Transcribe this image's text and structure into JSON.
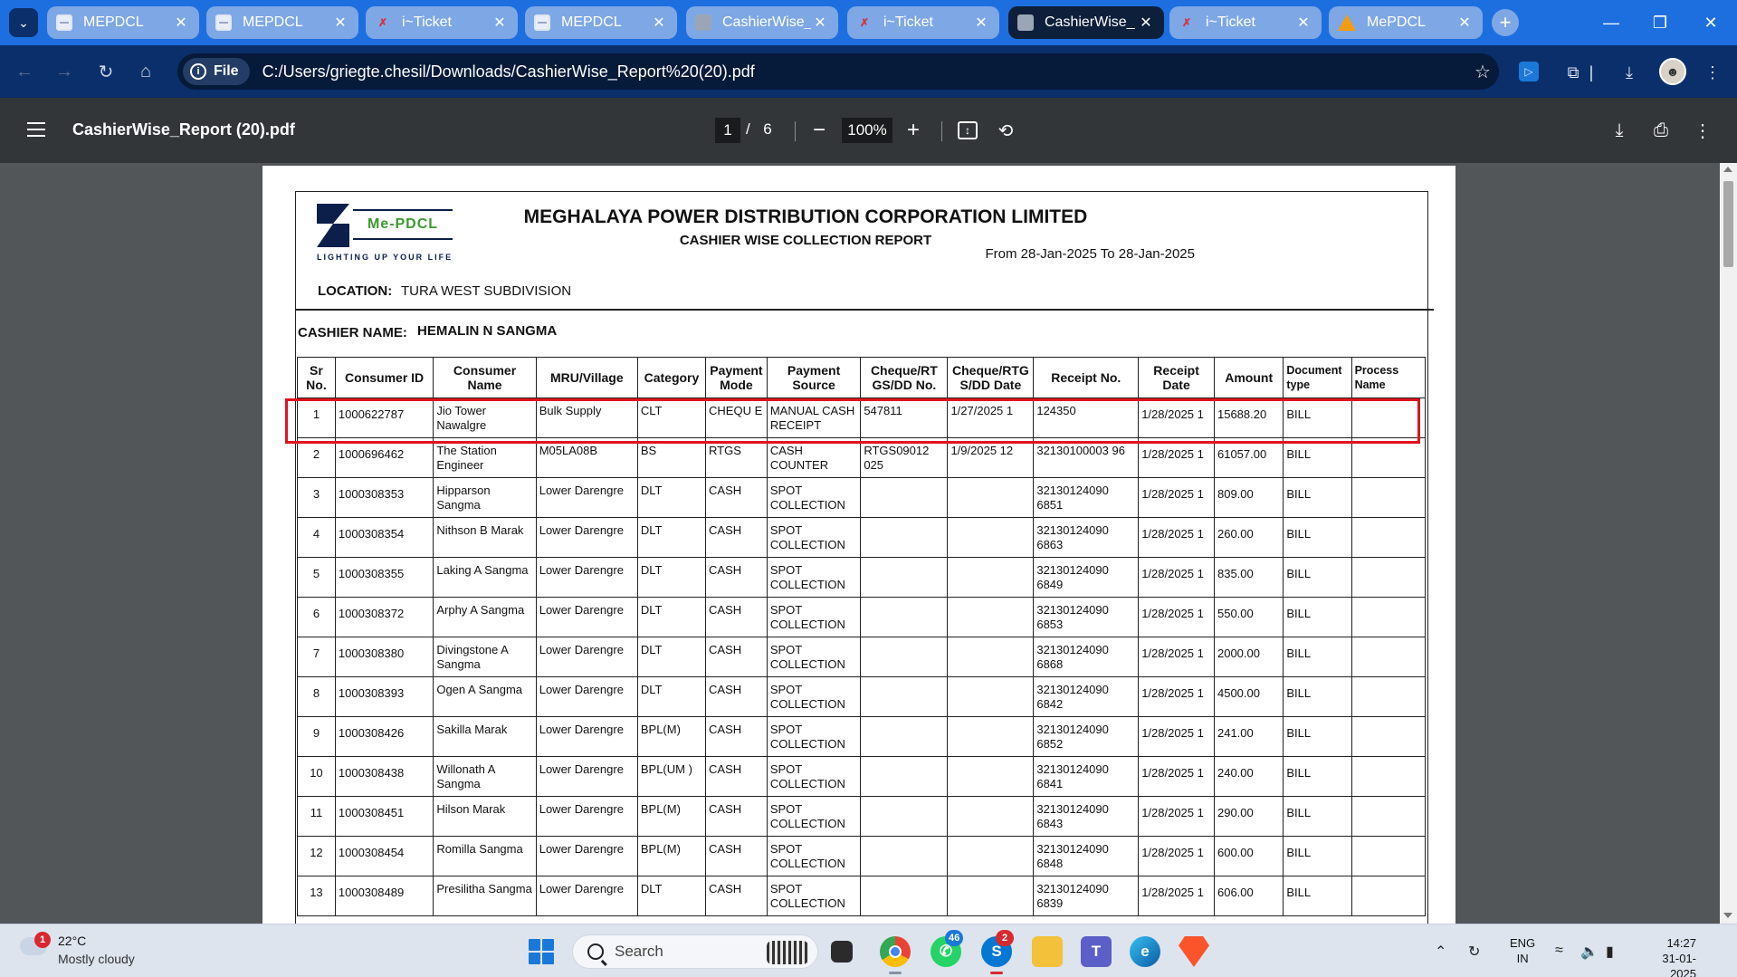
{
  "browser": {
    "tabs": [
      {
        "title": "MEPDCL",
        "icon": "doc-icon",
        "active": false
      },
      {
        "title": "MEPDCL",
        "icon": "doc-icon",
        "active": false
      },
      {
        "title": "i~Ticket",
        "icon": "ticket-icon",
        "active": false
      },
      {
        "title": "MEPDCL",
        "icon": "doc-icon",
        "active": false
      },
      {
        "title": "CashierWise_",
        "icon": "globe-icon",
        "active": false
      },
      {
        "title": "i~Ticket",
        "icon": "ticket-icon",
        "active": false
      },
      {
        "title": "CashierWise_",
        "icon": "globe-icon",
        "active": true
      },
      {
        "title": "i~Ticket",
        "icon": "ticket-icon",
        "active": false
      },
      {
        "title": "MePDCL",
        "icon": "warning-icon",
        "active": false
      }
    ],
    "address": {
      "chip_label": "File",
      "url": "C:/Users/griegte.chesil/Downloads/CashierWise_Report%20(20).pdf"
    }
  },
  "pdf_viewer": {
    "title": "CashierWise_Report (20).pdf",
    "current_page": "1",
    "separator": "/",
    "total_pages": "6",
    "zoom": "100%"
  },
  "report": {
    "logo_text": "Me-PDCL",
    "logo_tagline": "LIGHTING UP YOUR LIFE",
    "org": "MEGHALAYA POWER DISTRIBUTION CORPORATION LIMITED",
    "title": "CASHIER WISE COLLECTION REPORT",
    "date_range": "From 28-Jan-2025  To 28-Jan-2025",
    "location_label": "LOCATION:",
    "location": "TURA WEST SUBDIVISION",
    "cashier_label": "CASHIER NAME:",
    "cashier": "HEMALIN N SANGMA",
    "columns": [
      "Sr No.",
      "Consumer ID",
      "Consumer Name",
      "MRU/Village",
      "Category",
      "Payment Mode",
      "Payment Source",
      "Cheque/RT GS/DD No.",
      "Cheque/RTG S/DD Date",
      "Receipt No.",
      "Receipt Date",
      "Amount",
      "Document type",
      "Process Name"
    ],
    "rows": [
      [
        "1",
        "1000622787",
        "Jio Tower Nawalgre",
        "Bulk Supply",
        "CLT",
        "CHEQU E",
        "MANUAL CASH RECEIPT",
        "547811",
        "1/27/2025  1",
        "124350",
        "1/28/2025  1",
        "15688.20",
        "BILL",
        ""
      ],
      [
        "2",
        "1000696462",
        "The Station Engineer",
        "M05LA08B",
        "BS",
        "RTGS",
        "CASH COUNTER",
        "RTGS09012 025",
        "1/9/2025  12",
        "32130100003 96",
        "1/28/2025  1",
        "61057.00",
        "BILL",
        ""
      ],
      [
        "3",
        "1000308353",
        "Hipparson Sangma",
        "Lower Darengre",
        "DLT",
        "CASH",
        "SPOT COLLECTION",
        "",
        "",
        "32130124090 6851",
        "1/28/2025  1",
        "809.00",
        "BILL",
        ""
      ],
      [
        "4",
        "1000308354",
        "Nithson B Marak",
        "Lower Darengre",
        "DLT",
        "CASH",
        "SPOT COLLECTION",
        "",
        "",
        "32130124090 6863",
        "1/28/2025  1",
        "260.00",
        "BILL",
        ""
      ],
      [
        "5",
        "1000308355",
        "Laking A Sangma",
        "Lower Darengre",
        "DLT",
        "CASH",
        "SPOT COLLECTION",
        "",
        "",
        "32130124090 6849",
        "1/28/2025  1",
        "835.00",
        "BILL",
        ""
      ],
      [
        "6",
        "1000308372",
        "Arphy A Sangma",
        "Lower Darengre",
        "DLT",
        "CASH",
        "SPOT COLLECTION",
        "",
        "",
        "32130124090 6853",
        "1/28/2025  1",
        "550.00",
        "BILL",
        ""
      ],
      [
        "7",
        "1000308380",
        "Divingstone A Sangma",
        "Lower Darengre",
        "DLT",
        "CASH",
        "SPOT COLLECTION",
        "",
        "",
        "32130124090 6868",
        "1/28/2025  1",
        "2000.00",
        "BILL",
        ""
      ],
      [
        "8",
        "1000308393",
        "Ogen A Sangma",
        "Lower Darengre",
        "DLT",
        "CASH",
        "SPOT COLLECTION",
        "",
        "",
        "32130124090 6842",
        "1/28/2025  1",
        "4500.00",
        "BILL",
        ""
      ],
      [
        "9",
        "1000308426",
        "Sakilla Marak",
        "Lower Darengre",
        "BPL(M)",
        "CASH",
        "SPOT COLLECTION",
        "",
        "",
        "32130124090 6852",
        "1/28/2025  1",
        "241.00",
        "BILL",
        ""
      ],
      [
        "10",
        "1000308438",
        "Willonath A Sangma",
        "Lower Darengre",
        "BPL(UM )",
        "CASH",
        "SPOT COLLECTION",
        "",
        "",
        "32130124090 6841",
        "1/28/2025  1",
        "240.00",
        "BILL",
        ""
      ],
      [
        "11",
        "1000308451",
        "Hilson Marak",
        "Lower Darengre",
        "BPL(M)",
        "CASH",
        "SPOT COLLECTION",
        "",
        "",
        "32130124090 6843",
        "1/28/2025  1",
        "290.00",
        "BILL",
        ""
      ],
      [
        "12",
        "1000308454",
        "Romilla Sangma",
        "Lower Darengre",
        "BPL(M)",
        "CASH",
        "SPOT COLLECTION",
        "",
        "",
        "32130124090 6848",
        "1/28/2025  1",
        "600.00",
        "BILL",
        ""
      ],
      [
        "13",
        "1000308489",
        "Presilitha Sangma",
        "Lower Darengre",
        "DLT",
        "CASH",
        "SPOT COLLECTION",
        "",
        "",
        "32130124090 6839",
        "1/28/2025  1",
        "606.00",
        "BILL",
        ""
      ]
    ]
  },
  "taskbar": {
    "weather_alert": "1",
    "temperature": "22°C",
    "condition": "Mostly cloudy",
    "search_label": "Search",
    "whatsapp_badge": "46",
    "skype_badge": "2",
    "lang_top": "ENG",
    "lang_bottom": "IN",
    "time": "14:27",
    "date": "31-01-2025"
  },
  "colors": {
    "tabstrip": "#1d6fe0",
    "toolbar": "#0b2f6a",
    "pdf_toolbar": "#323639",
    "highlight": "#e0131f"
  }
}
